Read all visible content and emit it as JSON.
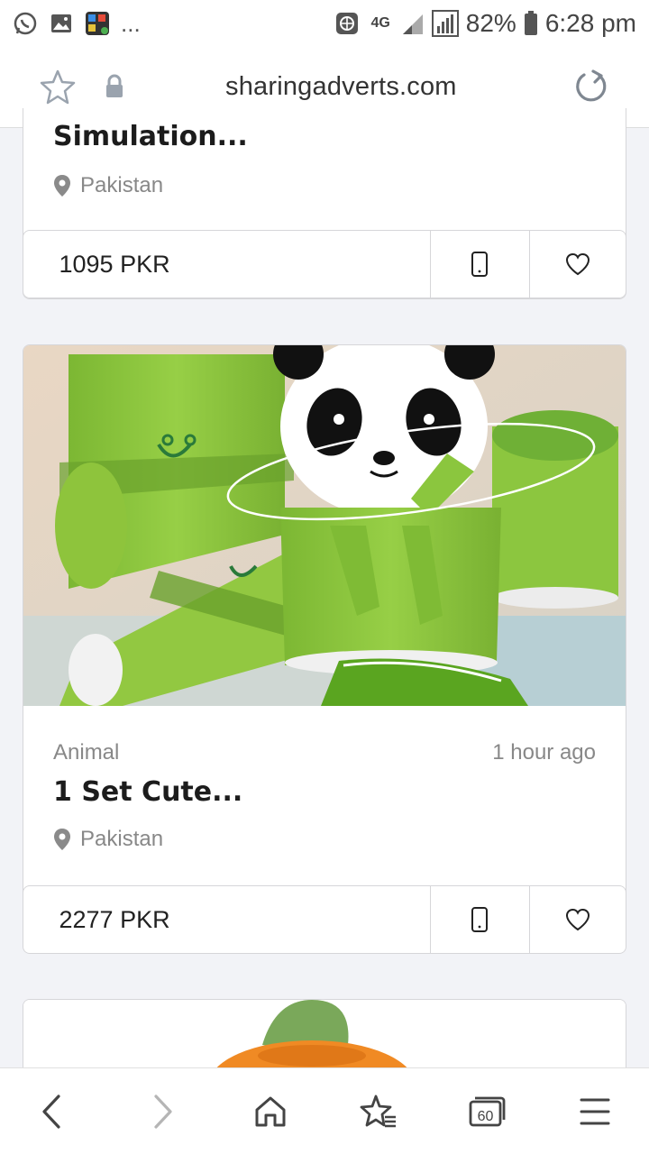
{
  "status": {
    "ellipsis": "...",
    "network": "4G",
    "battery": "82%",
    "time": "6:28 pm"
  },
  "browser": {
    "url": "sharingadverts.com"
  },
  "listings": [
    {
      "title": "Simulation...",
      "location": "Pakistan",
      "price": "1095 PKR"
    },
    {
      "category": "Animal",
      "posted": "1 hour ago",
      "title": "1 Set Cute...",
      "location": "Pakistan",
      "price": "2277 PKR"
    }
  ],
  "bottom_nav": {
    "tabs_count": "60"
  },
  "colors": {
    "plush_green": "#8cc63f",
    "accent_orange": "#f08a24"
  }
}
